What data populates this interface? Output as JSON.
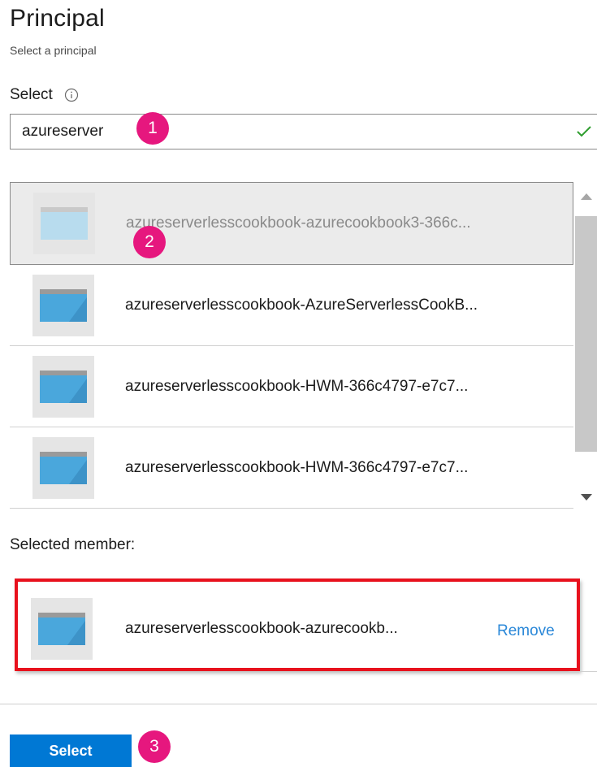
{
  "header": {
    "title": "Principal",
    "subtitle": "Select a principal"
  },
  "search": {
    "label": "Select",
    "value": "azureserver",
    "info_icon": "info-icon",
    "valid_icon": "checkmark-icon"
  },
  "results": [
    {
      "name": "azureserverlesscookbook-azurecookbook3-366c...",
      "icon": "app-window-icon"
    },
    {
      "name": "azureserverlesscookbook-AzureServerlessCookB...",
      "icon": "app-window-icon"
    },
    {
      "name": "azureserverlesscookbook-HWM-366c4797-e7c7...",
      "icon": "app-window-icon"
    },
    {
      "name": "azureserverlesscookbook-HWM-366c4797-e7c7...",
      "icon": "app-window-icon"
    }
  ],
  "selected": {
    "label": "Selected member:",
    "member": {
      "name": "azureserverlesscookbook-azurecookb...",
      "remove_label": "Remove",
      "icon": "app-window-icon"
    }
  },
  "footer": {
    "select_label": "Select"
  },
  "badges": [
    "1",
    "2",
    "3"
  ],
  "colors": {
    "badge": "#e6177e",
    "highlight_border": "#e8111d",
    "primary_button": "#0078d4",
    "link": "#2b88d8",
    "check": "#2f9e2f"
  }
}
